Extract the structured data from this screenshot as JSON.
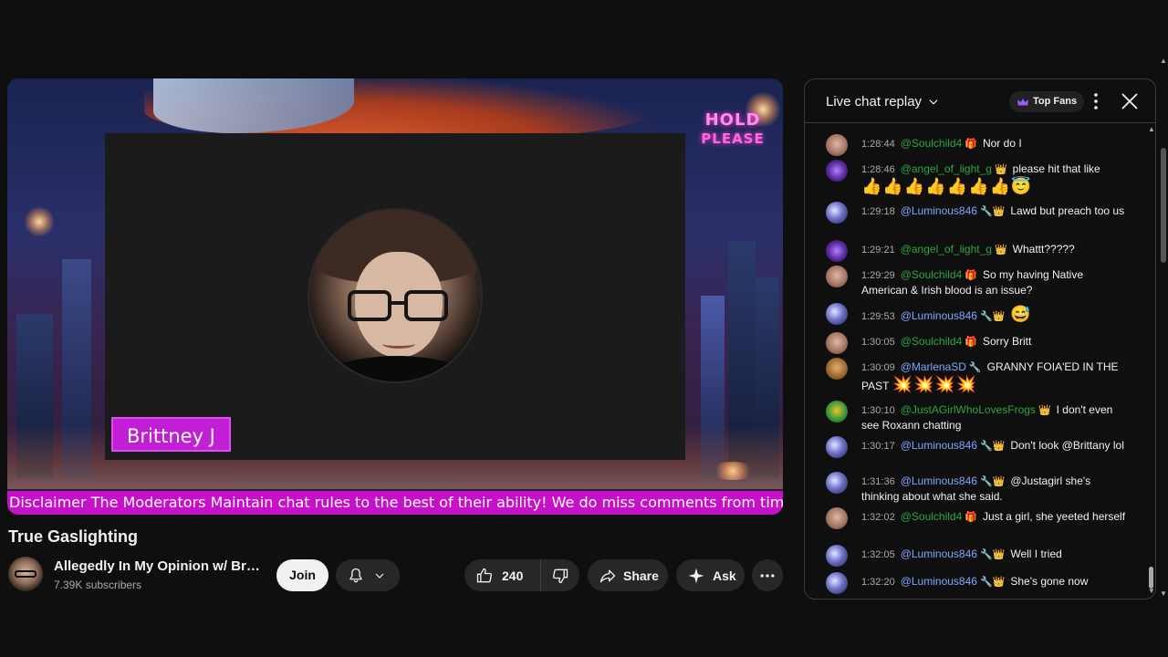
{
  "video": {
    "overlay_sign": [
      "HOLD",
      "PLEASE"
    ],
    "presenter_name": "Brittney J",
    "ticker_text": "Disclaimer The Moderators Maintain chat rules to the best of their ability! We do miss comments from time",
    "script_text": "Brittney J"
  },
  "info": {
    "title": "True Gaslighting",
    "channel_name": "Allegedly In My Opinion w/ Brit...",
    "subscribers": "7.39K subscribers",
    "join_label": "Join",
    "like_count": "240",
    "share_label": "Share",
    "ask_label": "Ask"
  },
  "chat": {
    "title": "Live chat replay",
    "top_fans_label": "Top Fans",
    "messages": [
      {
        "time": "1:28:44",
        "author": "@Soulchild4",
        "badge": "🎁",
        "text": "Nor do I",
        "avatar": "soul",
        "author_color": "green"
      },
      {
        "time": "1:28:46",
        "author": "@angel_of_light_g",
        "badge": "👑",
        "text": "please hit that like",
        "emoji": "👍👍👍👍👍👍👍😇",
        "avatar": "angel",
        "author_color": "green"
      },
      {
        "time": "1:29:18",
        "author": "@Luminous846",
        "badge": "🔧👑",
        "text": "Lawd but preach too us",
        "avatar": "lum",
        "author_color": "blue"
      },
      {
        "time": "1:29:21",
        "author": "@angel_of_light_g",
        "badge": "👑",
        "text": "Whattt?????",
        "avatar": "angel",
        "author_color": "green"
      },
      {
        "time": "1:29:29",
        "author": "@Soulchild4",
        "badge": "🎁",
        "text": "So my having Native American & Irish blood is an issue?",
        "avatar": "soul",
        "author_color": "green"
      },
      {
        "time": "1:29:53",
        "author": "@Luminous846",
        "badge": "🔧👑",
        "text": "😅",
        "avatar": "lum",
        "author_color": "blue"
      },
      {
        "time": "1:30:05",
        "author": "@Soulchild4",
        "badge": "🎁",
        "text": "Sorry Britt",
        "avatar": "soul",
        "author_color": "green"
      },
      {
        "time": "1:30:09",
        "author": "@MarlenaSD",
        "badge": "🔧",
        "text": "GRANNY FOIA'ED IN THE PAST",
        "emoji": "💥💥💥💥",
        "avatar": "marl",
        "author_color": "blue"
      },
      {
        "time": "1:30:10",
        "author": "@JustAGirlWhoLovesFrogs",
        "badge": "👑",
        "text": "I don't even see Roxann chatting",
        "avatar": "just",
        "author_color": "green"
      },
      {
        "time": "1:30:17",
        "author": "@Luminous846",
        "badge": "🔧👑",
        "text": "Don't look @Brittany lol",
        "avatar": "lum",
        "author_color": "blue"
      },
      {
        "time": "1:31:36",
        "author": "@Luminous846",
        "badge": "🔧👑",
        "text": "@Justagirl she's thinking about what she said.",
        "avatar": "lum",
        "author_color": "blue"
      },
      {
        "time": "1:32:02",
        "author": "@Soulchild4",
        "badge": "🎁",
        "text": "Just a girl, she yeeted herself",
        "avatar": "soul",
        "author_color": "green"
      },
      {
        "time": "1:32:05",
        "author": "@Luminous846",
        "badge": "🔧👑",
        "text": "Well I tried",
        "avatar": "lum",
        "author_color": "blue"
      },
      {
        "time": "1:32:20",
        "author": "@Luminous846",
        "badge": "🔧👑",
        "text": "She's gone now",
        "avatar": "lum",
        "author_color": "blue"
      }
    ]
  },
  "icons": {
    "bell": "bell-icon",
    "chevron": "chevron-down-icon",
    "like": "thumb-up-icon",
    "dislike": "thumb-down-icon",
    "share": "share-icon",
    "ask": "sparkle-icon",
    "more": "more-horizontal-icon",
    "kebab": "more-vertical-icon",
    "close": "close-icon",
    "crown": "crown-icon"
  },
  "colors": {
    "ticker": "#c611c9",
    "name_tag": "#c21ed6",
    "author_green": "#2ba640",
    "author_blue": "#7da7ff"
  }
}
